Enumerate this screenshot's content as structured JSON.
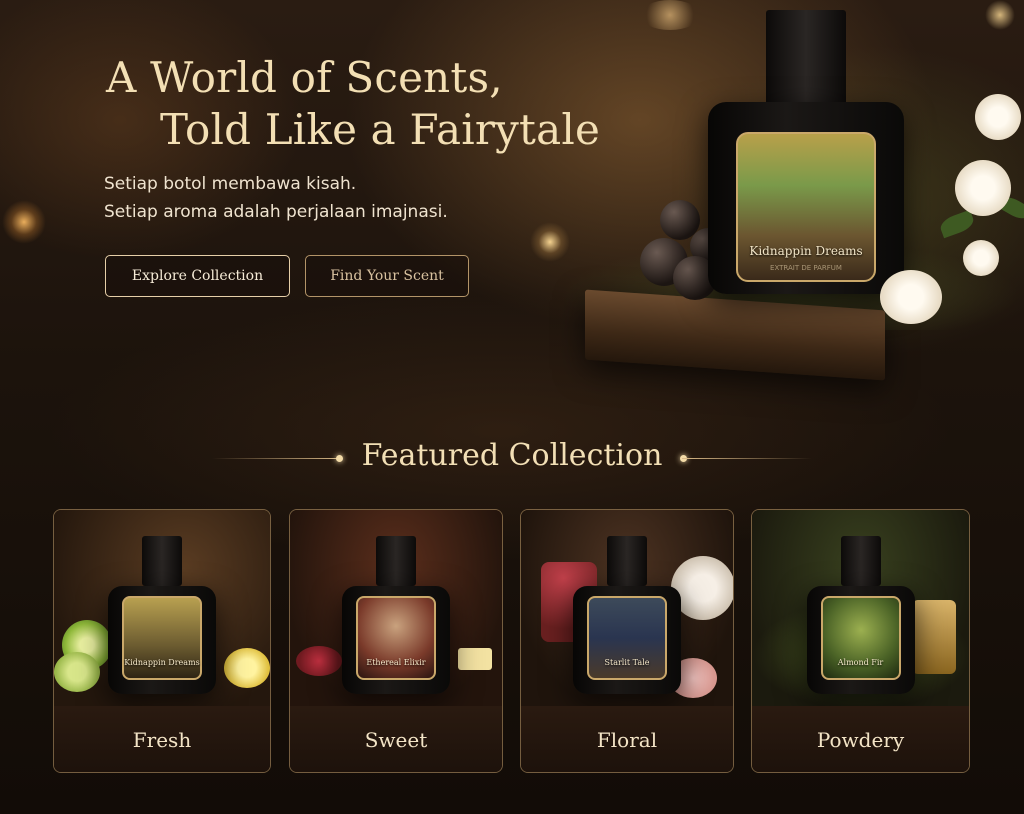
{
  "hero": {
    "title_line1": "A World of Scents,",
    "title_line2": "Told Like a Fairytale",
    "subtitle_line1": "Setiap botol membawa kisah.",
    "subtitle_line2": "Setiap aroma adalah perjalaan imajnasi.",
    "buttons": {
      "explore": "Explore Collection",
      "find": "Find Your Scent"
    },
    "product": {
      "label_name": "Kidnappin Dreams",
      "label_sub": "EXTRAIT DE PARFUM"
    }
  },
  "featured": {
    "title": "Featured Collection",
    "cards": [
      {
        "category": "Fresh",
        "bottle_label": "Kidnappin Dreams"
      },
      {
        "category": "Sweet",
        "bottle_label": "Ethereal Elixir"
      },
      {
        "category": "Floral",
        "bottle_label": "Starlit Tale"
      },
      {
        "category": "Powdery",
        "bottle_label": "Almond Fir"
      }
    ]
  },
  "colors": {
    "accent_gold": "#d9b987",
    "title_cream": "#f3dfb4",
    "background": "#140d08"
  }
}
